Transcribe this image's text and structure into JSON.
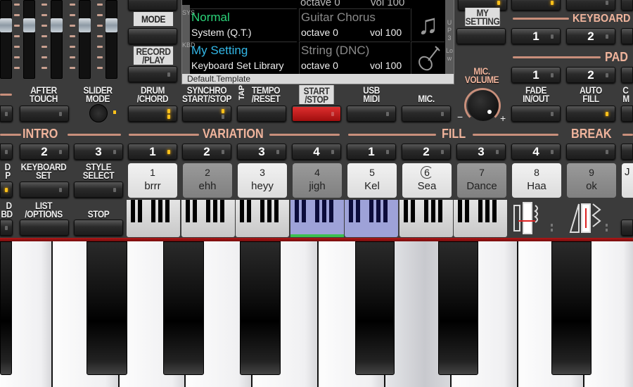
{
  "display": {
    "top_row": {
      "octave": "octave 0",
      "vol": "vol 100"
    },
    "sys": {
      "label": "SYS",
      "mode": "Normal",
      "sub": "System (Q.T.)",
      "mode_color": "#2bd47a"
    },
    "kbd": {
      "label": "KBD",
      "mode": "My Setting",
      "sub": "Keyboard Set Library",
      "mode_color": "#33b8e8"
    },
    "voices": [
      {
        "name": "Guitar Chorus",
        "octave": "octave 0",
        "vol": "vol 100",
        "icon": "music-note-icon"
      },
      {
        "name": "String (DNC)",
        "octave": "octave 0",
        "vol": "vol 100",
        "icon": "violin-icon"
      }
    ],
    "side_labels": [
      "UP3",
      "Low"
    ],
    "footer": "Default.Template"
  },
  "labels": {
    "mode": "MODE",
    "record_play": "RECORD\n/PLAY",
    "my_setting": "MY\nSETTING",
    "after_touch": "AFTER\nTOUCH",
    "slider_mode": "SLIDER\nMODE",
    "drum_chord": "DRUM\n/CHORD",
    "synchro": "SYNCHRO\nSTART/STOP",
    "tap": "TAP",
    "tempo_reset": "TEMPO\n/RESET",
    "start_stop": "START\n/STOP",
    "usb_midi": "USB\nMIDI",
    "mic": "MIC.",
    "mic_volume": "MIC.\nVOLUME",
    "mic_minus": "−",
    "mic_plus": "+",
    "fade": "FADE\nIN/OUT",
    "auto_fill": "AUTO\nFILL",
    "partial_c": "C\nM",
    "keyboard_set": "KEYBOARD\nSET",
    "style_select": "STYLE\nSELECT",
    "partial_dp": "D\nP",
    "list_options": "LIST\n/OPTIONS",
    "stop": "STOP",
    "partial_dbd": "D\nBD"
  },
  "headers": {
    "keyboard": "KEYBOARD",
    "pad": "PAD",
    "intro": "INTRO",
    "variation": "VARIATION",
    "fill": "FILL",
    "break": "BREAK"
  },
  "keyboard_buttons": [
    "1",
    "2"
  ],
  "pad_buttons": [
    "1",
    "2"
  ],
  "intro_buttons": [
    "2",
    "3"
  ],
  "variation_buttons": [
    {
      "n": "1",
      "on": true
    },
    {
      "n": "2",
      "on": false
    },
    {
      "n": "3",
      "on": false
    },
    {
      "n": "4",
      "on": false
    }
  ],
  "fill_buttons": [
    "1",
    "2",
    "3",
    "4"
  ],
  "pads": [
    {
      "num": "1",
      "name": "brrr",
      "lit": true
    },
    {
      "num": "2",
      "name": "ehh",
      "lit": false
    },
    {
      "num": "3",
      "name": "heyy",
      "lit": true
    },
    {
      "num": "4",
      "name": "jigh",
      "lit": false
    },
    {
      "num": "5",
      "name": "Kel",
      "lit": true
    },
    {
      "num": "6",
      "name": "Sea",
      "lit": true,
      "loop": true
    },
    {
      "num": "7",
      "name": "Dance",
      "lit": false
    },
    {
      "num": "8",
      "name": "Haa",
      "lit": true
    },
    {
      "num": "9",
      "name": "ok",
      "lit": false
    },
    {
      "num": "",
      "name": "J",
      "lit": true
    }
  ],
  "mini_keyboard": {
    "octaves": 7,
    "highlighted": [
      3,
      4
    ],
    "active_marker": 3,
    "highlight_color": "#9ea2d8",
    "marker_color": "#3cc050"
  },
  "mic_volume_level": 0.7,
  "colors": {
    "accent": "#f0b49c",
    "start_stop": "#c01818",
    "stripe": "#8b0e0e"
  }
}
